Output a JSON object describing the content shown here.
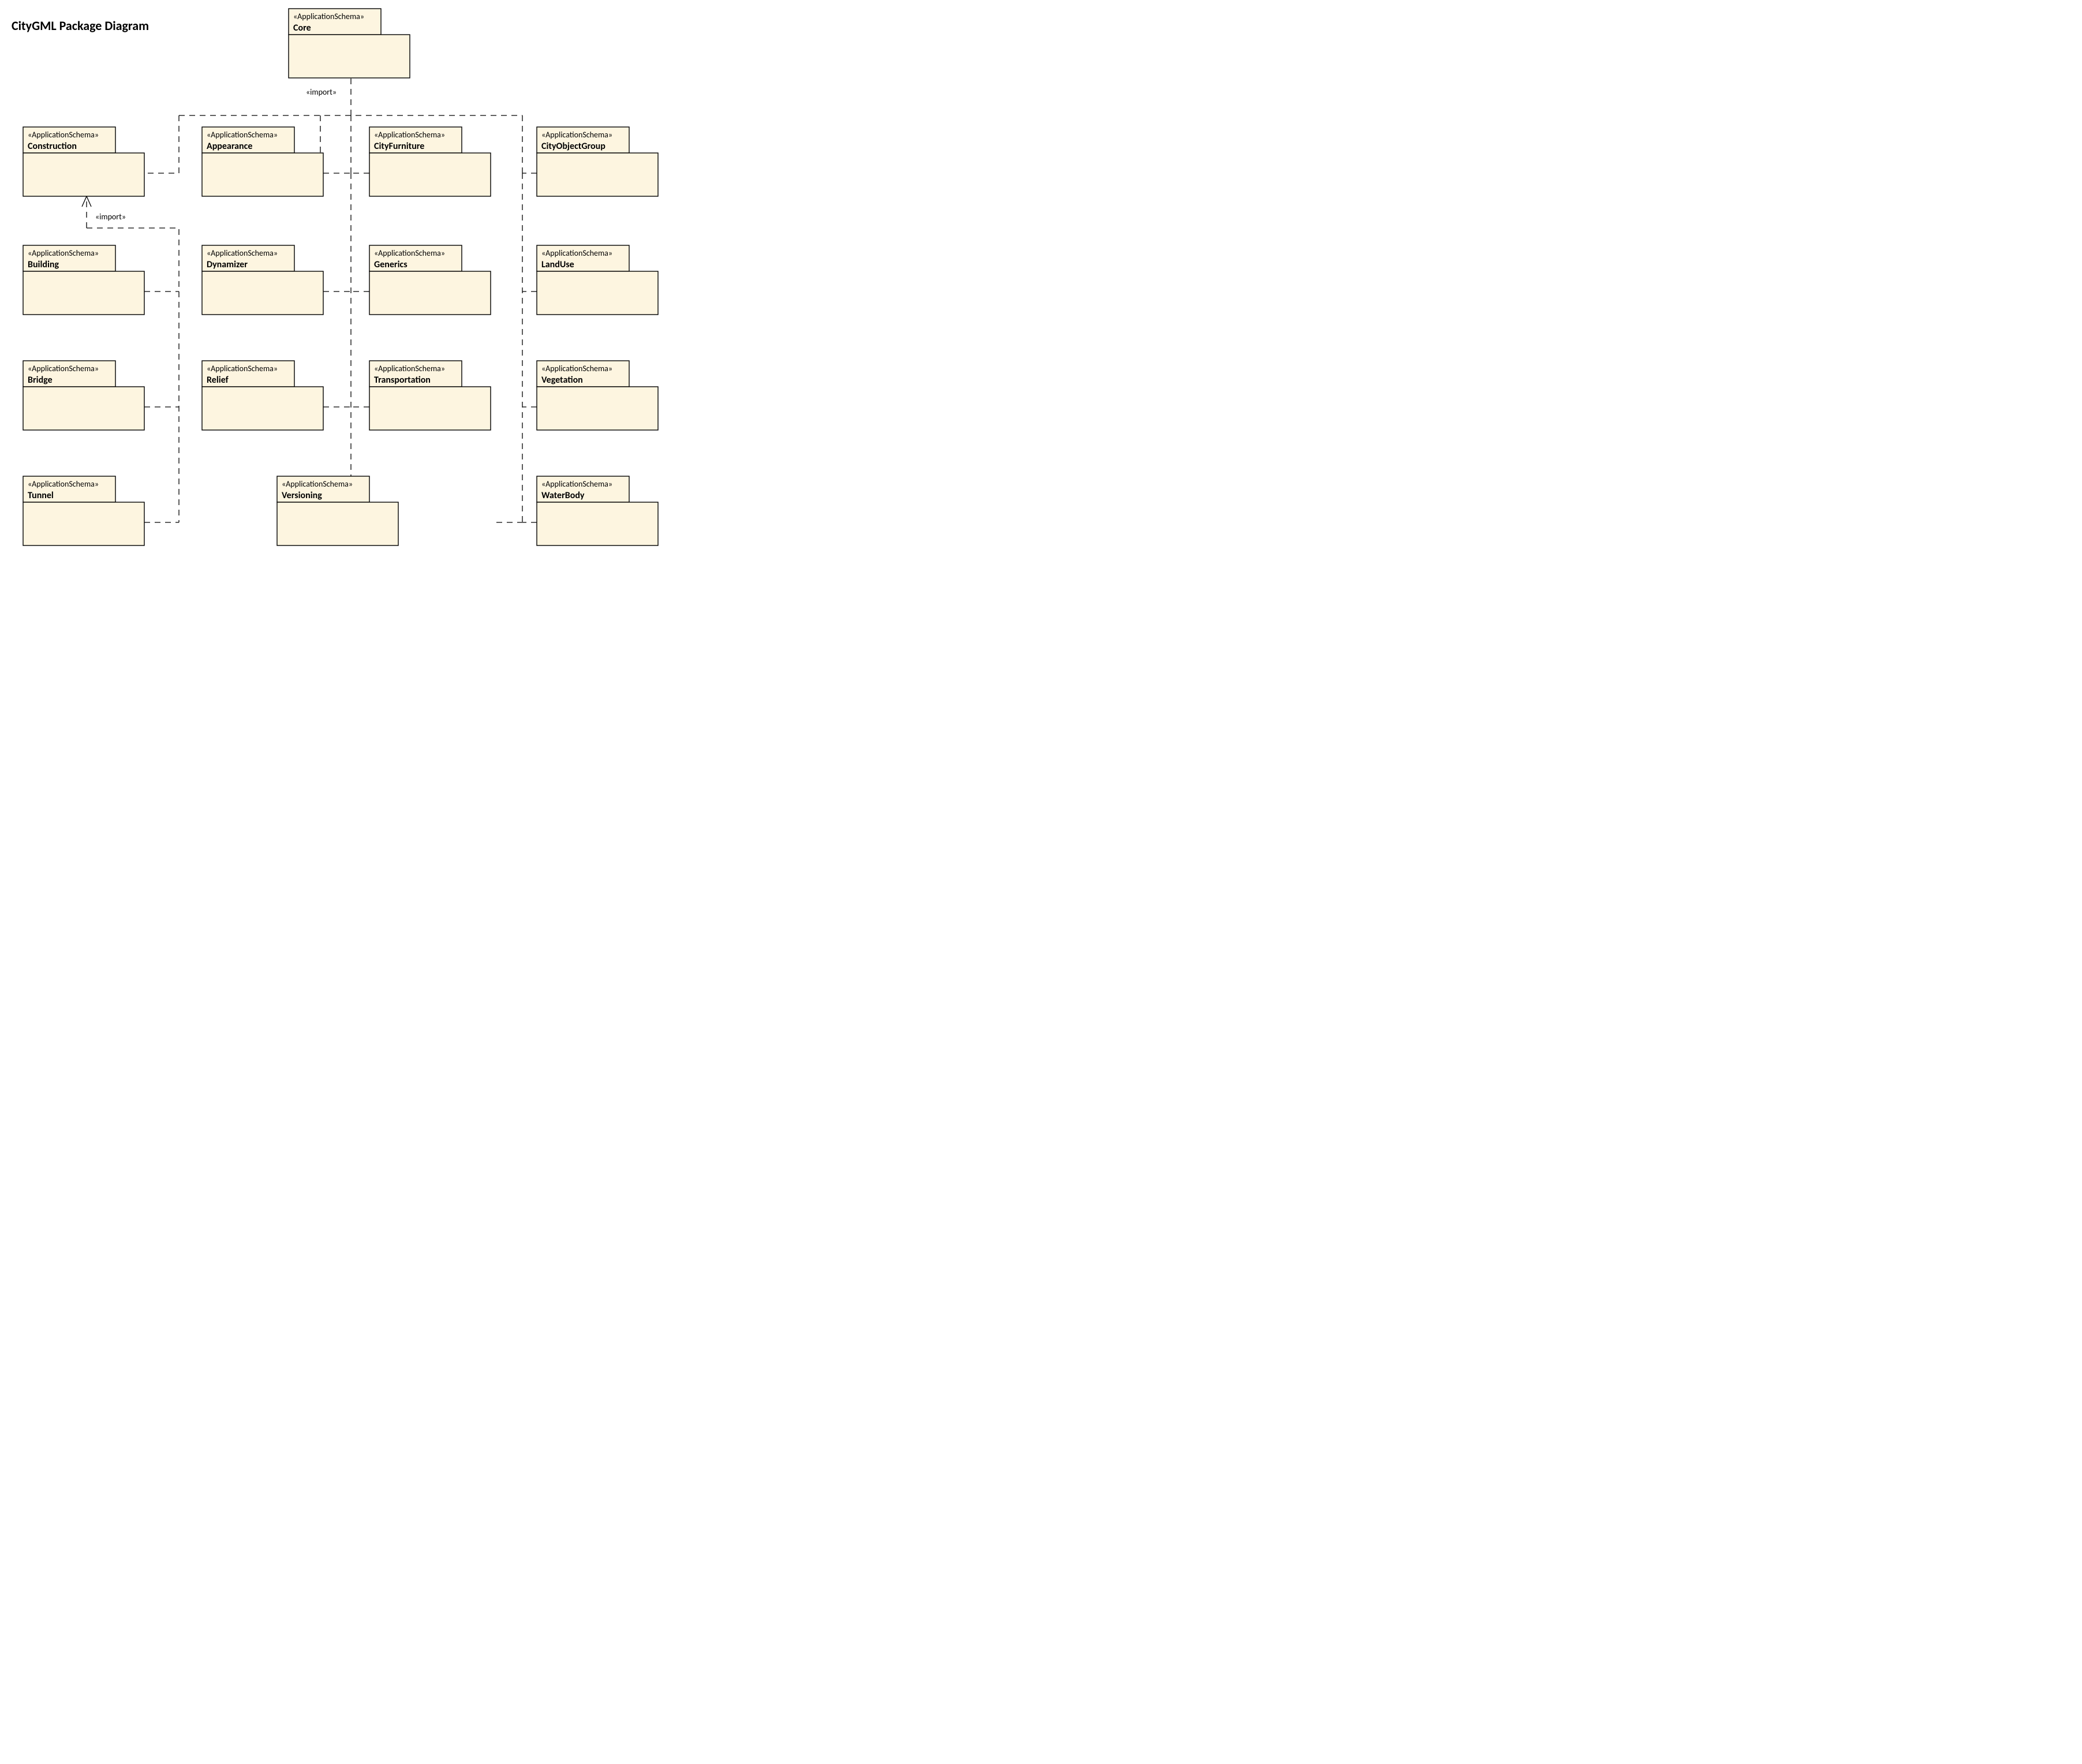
{
  "title": "CityGML Package Diagram",
  "stereotype": "«ApplicationSchema»",
  "labels": {
    "import": "«import»"
  },
  "packages": {
    "core": {
      "name": "Core"
    },
    "construction": {
      "name": "Construction"
    },
    "appearance": {
      "name": "Appearance"
    },
    "cityfurniture": {
      "name": "CityFurniture"
    },
    "cityobjectgroup": {
      "name": "CityObjectGroup"
    },
    "building": {
      "name": "Building"
    },
    "dynamizer": {
      "name": "Dynamizer"
    },
    "generics": {
      "name": "Generics"
    },
    "landuse": {
      "name": "LandUse"
    },
    "bridge": {
      "name": "Bridge"
    },
    "relief": {
      "name": "Relief"
    },
    "transportation": {
      "name": "Transportation"
    },
    "vegetation": {
      "name": "Vegetation"
    },
    "tunnel": {
      "name": "Tunnel"
    },
    "versioning": {
      "name": "Versioning"
    },
    "waterbody": {
      "name": "WaterBody"
    }
  }
}
